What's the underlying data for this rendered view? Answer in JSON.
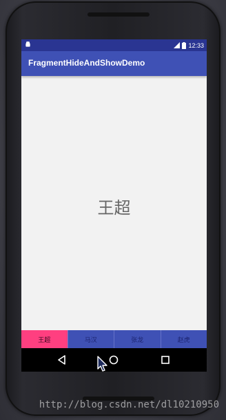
{
  "status_bar": {
    "time": "12:33",
    "icons": [
      "android-notification-icon",
      "signal-icon",
      "battery-icon"
    ],
    "color": "#2a3592"
  },
  "app_bar": {
    "title": "FragmentHideAndShowDemo",
    "color": "#3f51b5"
  },
  "content": {
    "text": "王超"
  },
  "tabs": [
    {
      "label": "王超",
      "active": true
    },
    {
      "label": "马汉",
      "active": false
    },
    {
      "label": "张龙",
      "active": false
    },
    {
      "label": "赵虎",
      "active": false
    }
  ],
  "tab_colors": {
    "active": "#ff3f80",
    "inactive": "#3f51b5"
  },
  "nav_bar": {
    "icons": [
      "back-icon",
      "home-icon",
      "recents-icon"
    ]
  },
  "watermark": "http://blog.csdn.net/dl10210950"
}
